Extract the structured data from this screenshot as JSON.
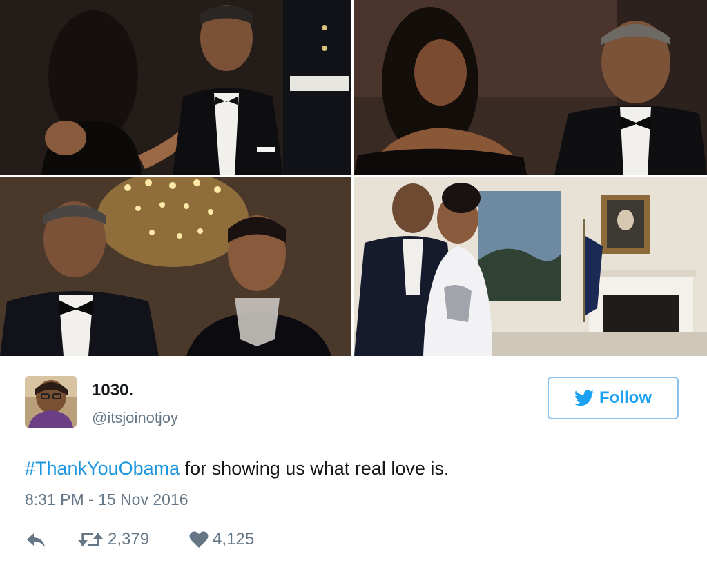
{
  "photos": [
    {
      "name": "photo-top-left"
    },
    {
      "name": "photo-top-right"
    },
    {
      "name": "photo-bottom-left"
    },
    {
      "name": "photo-bottom-right"
    }
  ],
  "tweet": {
    "display_name": "1030.",
    "handle": "@itsjoinotjoy",
    "follow_label": "Follow",
    "hashtag": "#ThankYouObama",
    "text_rest": " for showing us what real love is.",
    "timestamp": "8:31 PM - 15 Nov 2016",
    "retweets": "2,379",
    "likes": "4,125"
  },
  "icons": {
    "follow": "twitter-bird-icon",
    "reply": "reply-icon",
    "retweet": "retweet-icon",
    "like": "heart-icon"
  },
  "colors": {
    "accent": "#1da1f2",
    "hashtag": "#1b95e0",
    "follow_border": "#88c2ee",
    "secondary_text": "#657786",
    "primary_text": "#14171a"
  }
}
